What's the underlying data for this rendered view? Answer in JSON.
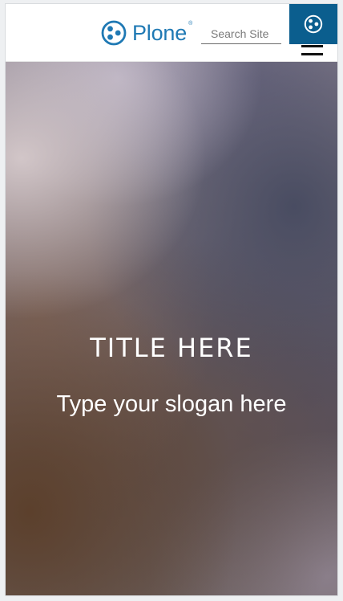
{
  "header": {
    "logo_text": "Plone",
    "logo_reg": "®",
    "brand_color": "#1f79b4",
    "search": {
      "placeholder": "Search Site",
      "value": ""
    },
    "toolbar_color": "#0b5e8e",
    "toolbar_icon": "plone-toolbar-icon",
    "menu_icon": "hamburger-icon"
  },
  "hero": {
    "title": "TITLE HERE",
    "slogan": "Type your slogan here"
  }
}
